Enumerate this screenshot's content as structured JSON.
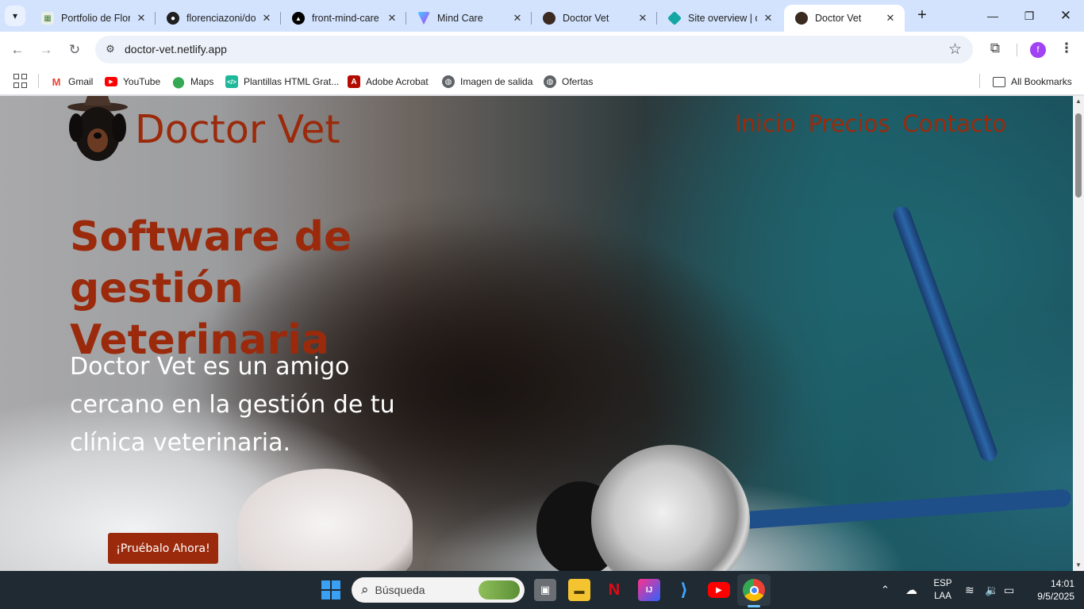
{
  "browser": {
    "tabs": [
      {
        "title": "Portfolio de Flor",
        "icon": "portfolio-favicon-icon",
        "active": false
      },
      {
        "title": "florenciazoni/do",
        "icon": "github-icon",
        "active": false
      },
      {
        "title": "front-mind-care",
        "icon": "vercel-icon",
        "active": false
      },
      {
        "title": "Mind Care",
        "icon": "vite-icon",
        "active": false
      },
      {
        "title": "Doctor Vet",
        "icon": "doctor-vet-favicon-icon",
        "active": false
      },
      {
        "title": "Site overview | d",
        "icon": "netlify-icon",
        "active": false
      },
      {
        "title": "Doctor Vet",
        "icon": "doctor-vet-favicon-icon",
        "active": true
      }
    ],
    "new_tab_label": "+",
    "url": "doctor-vet.netlify.app",
    "profile_initial": "f",
    "bookmarks": [
      {
        "label": "Gmail",
        "icon": "gmail-icon"
      },
      {
        "label": "YouTube",
        "icon": "youtube-icon"
      },
      {
        "label": "Maps",
        "icon": "maps-icon"
      },
      {
        "label": "Plantillas HTML Grat...",
        "icon": "code-icon"
      },
      {
        "label": "Adobe Acrobat",
        "icon": "acrobat-icon"
      },
      {
        "label": "Imagen de salida",
        "icon": "globe-icon"
      },
      {
        "label": "Ofertas",
        "icon": "globe-icon"
      }
    ],
    "all_bookmarks_label": "All Bookmarks"
  },
  "page": {
    "brand": "Doctor Vet",
    "nav": [
      "Inicio",
      "Precios",
      "Contacto"
    ],
    "headline": "Software de gestión Veterinaria",
    "subtitle": "Doctor Vet es un amigo cercano en la gestión de tu clínica veterinaria.",
    "cta_label": "¡Pruébalo Ahora!",
    "accent_color": "#9b2a0c"
  },
  "taskbar": {
    "search_placeholder": "Búsqueda",
    "language_line1": "ESP",
    "language_line2": "LAA",
    "time": "14:01",
    "date": "9/5/2025"
  }
}
